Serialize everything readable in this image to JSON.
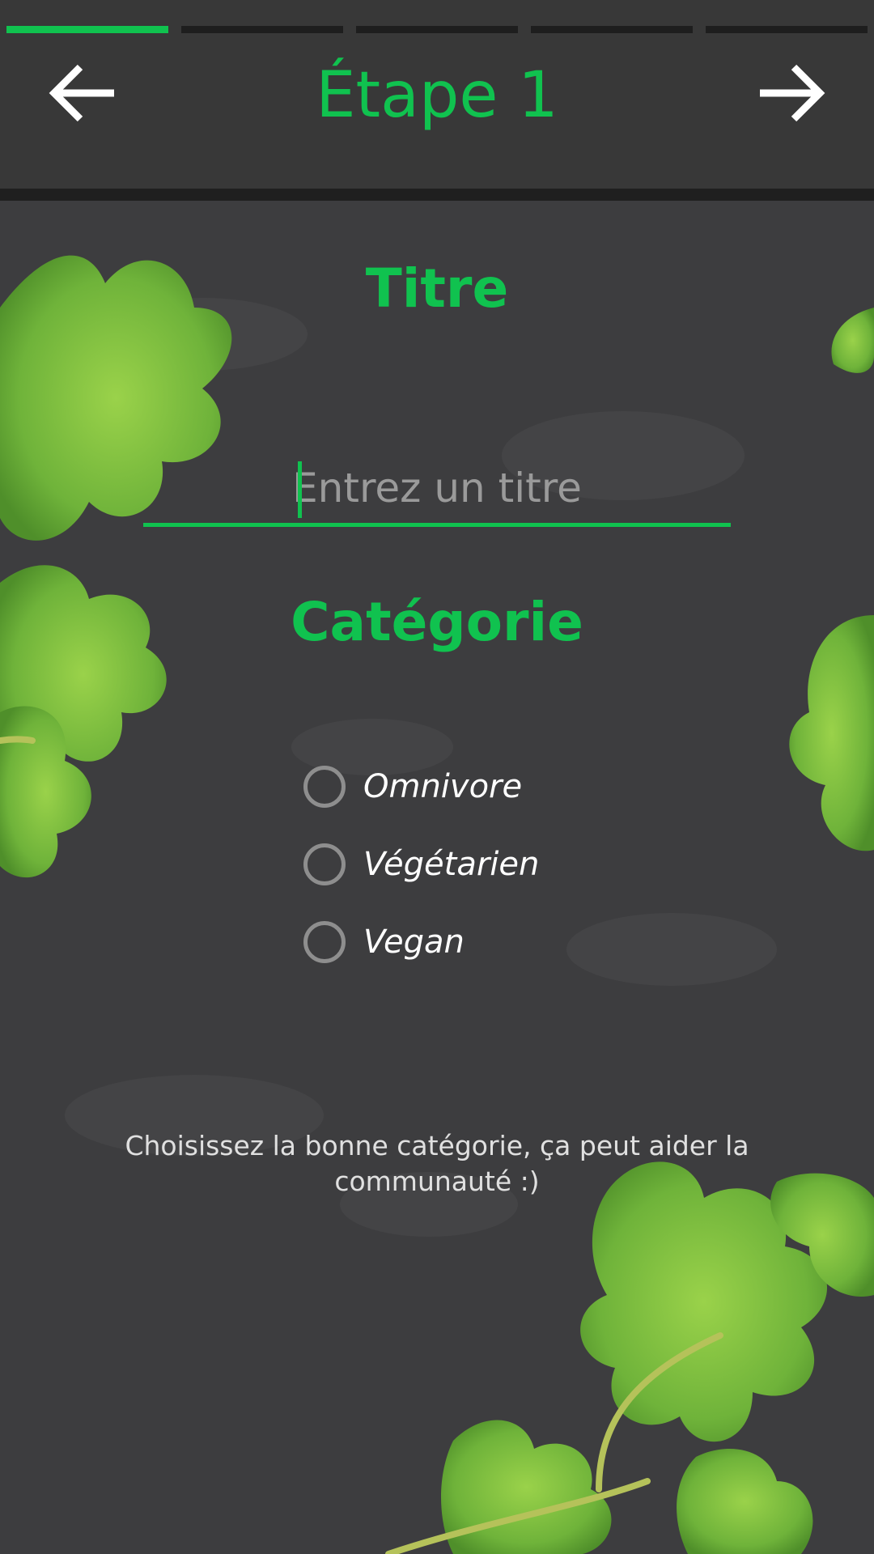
{
  "header": {
    "title": "Étape 1",
    "steps": [
      {
        "active": true
      },
      {
        "active": false
      },
      {
        "active": false
      },
      {
        "active": false
      },
      {
        "active": false
      }
    ],
    "back_icon": "arrow-left-icon",
    "next_icon": "arrow-right-icon"
  },
  "form": {
    "title_heading": "Titre",
    "title_placeholder": "Entrez un titre",
    "title_value": "",
    "category_heading": "Catégorie",
    "categories": [
      {
        "label": "Omnivore",
        "selected": false
      },
      {
        "label": "Végétarien",
        "selected": false
      },
      {
        "label": "Vegan",
        "selected": false
      }
    ],
    "hint": "Choisissez la bonne catégorie, ça peut aider la communauté :)"
  },
  "colors": {
    "accent": "#10c24f",
    "background": "#3d3d3f",
    "header": "#383838",
    "leaf": "#7cc13a"
  }
}
